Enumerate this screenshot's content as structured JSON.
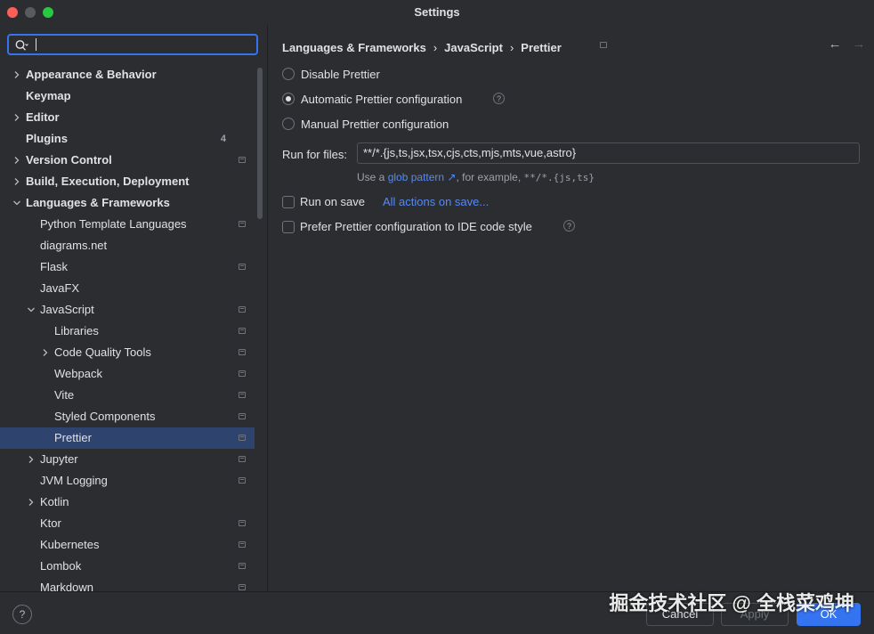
{
  "window": {
    "title": "Settings"
  },
  "search": {
    "value": ""
  },
  "sidebar": {
    "items": [
      {
        "label": "Appearance & Behavior",
        "level": 0,
        "bold": true,
        "chevron": "right",
        "badge": "",
        "project": false,
        "selected": false
      },
      {
        "label": "Keymap",
        "level": 0,
        "bold": true,
        "chevron": "",
        "badge": "",
        "project": false,
        "selected": false
      },
      {
        "label": "Editor",
        "level": 0,
        "bold": true,
        "chevron": "right",
        "badge": "",
        "project": false,
        "selected": false
      },
      {
        "label": "Plugins",
        "level": 0,
        "bold": true,
        "chevron": "",
        "badge": "4",
        "project": false,
        "selected": false
      },
      {
        "label": "Version Control",
        "level": 0,
        "bold": true,
        "chevron": "right",
        "badge": "",
        "project": true,
        "selected": false
      },
      {
        "label": "Build, Execution, Deployment",
        "level": 0,
        "bold": true,
        "chevron": "right",
        "badge": "",
        "project": false,
        "selected": false
      },
      {
        "label": "Languages & Frameworks",
        "level": 0,
        "bold": true,
        "chevron": "down",
        "badge": "",
        "project": false,
        "selected": false
      },
      {
        "label": "Python Template Languages",
        "level": 1,
        "bold": false,
        "chevron": "",
        "badge": "",
        "project": true,
        "selected": false
      },
      {
        "label": "diagrams.net",
        "level": 1,
        "bold": false,
        "chevron": "",
        "badge": "",
        "project": false,
        "selected": false
      },
      {
        "label": "Flask",
        "level": 1,
        "bold": false,
        "chevron": "",
        "badge": "",
        "project": true,
        "selected": false
      },
      {
        "label": "JavaFX",
        "level": 1,
        "bold": false,
        "chevron": "",
        "badge": "",
        "project": false,
        "selected": false
      },
      {
        "label": "JavaScript",
        "level": 1,
        "bold": false,
        "chevron": "down",
        "badge": "",
        "project": true,
        "selected": false
      },
      {
        "label": "Libraries",
        "level": 2,
        "bold": false,
        "chevron": "",
        "badge": "",
        "project": true,
        "selected": false
      },
      {
        "label": "Code Quality Tools",
        "level": 2,
        "bold": false,
        "chevron": "right",
        "badge": "",
        "project": true,
        "selected": false
      },
      {
        "label": "Webpack",
        "level": 2,
        "bold": false,
        "chevron": "",
        "badge": "",
        "project": true,
        "selected": false
      },
      {
        "label": "Vite",
        "level": 2,
        "bold": false,
        "chevron": "",
        "badge": "",
        "project": true,
        "selected": false
      },
      {
        "label": "Styled Components",
        "level": 2,
        "bold": false,
        "chevron": "",
        "badge": "",
        "project": true,
        "selected": false
      },
      {
        "label": "Prettier",
        "level": 2,
        "bold": false,
        "chevron": "",
        "badge": "",
        "project": true,
        "selected": true
      },
      {
        "label": "Jupyter",
        "level": 1,
        "bold": false,
        "chevron": "right",
        "badge": "",
        "project": true,
        "selected": false
      },
      {
        "label": "JVM Logging",
        "level": 1,
        "bold": false,
        "chevron": "",
        "badge": "",
        "project": true,
        "selected": false
      },
      {
        "label": "Kotlin",
        "level": 1,
        "bold": false,
        "chevron": "right",
        "badge": "",
        "project": false,
        "selected": false
      },
      {
        "label": "Ktor",
        "level": 1,
        "bold": false,
        "chevron": "",
        "badge": "",
        "project": true,
        "selected": false
      },
      {
        "label": "Kubernetes",
        "level": 1,
        "bold": false,
        "chevron": "",
        "badge": "",
        "project": true,
        "selected": false
      },
      {
        "label": "Lombok",
        "level": 1,
        "bold": false,
        "chevron": "",
        "badge": "",
        "project": true,
        "selected": false
      },
      {
        "label": "Markdown",
        "level": 1,
        "bold": false,
        "chevron": "",
        "badge": "",
        "project": true,
        "selected": false
      }
    ]
  },
  "breadcrumb": [
    "Languages & Frameworks",
    "JavaScript",
    "Prettier"
  ],
  "breadcrumb_sep": "›",
  "nav": {
    "back_icon": "arrow-left-icon",
    "forward_icon": "arrow-right-icon"
  },
  "prettier": {
    "radio_disable": "Disable Prettier",
    "radio_automatic": "Automatic Prettier configuration",
    "radio_manual": "Manual Prettier configuration",
    "selected_mode": "automatic",
    "run_for_files_label": "Run for files:",
    "run_for_files_value": "**/*.{js,ts,jsx,tsx,cjs,cts,mjs,mts,vue,astro}",
    "hint_prefix": "Use a",
    "hint_link": "glob pattern ↗",
    "hint_middle": ", for example,",
    "hint_example": "**/*.{js,ts}",
    "run_on_save_label": "Run on save",
    "run_on_save_checked": false,
    "all_actions_link": "All actions on save...",
    "prefer_config_label": "Prefer Prettier configuration to IDE code style",
    "prefer_config_checked": false
  },
  "footer": {
    "help_label": "?",
    "cancel_label": "Cancel",
    "apply_label": "Apply",
    "ok_label": "OK"
  },
  "watermark": "掘金技术社区 @ 全栈菜鸡坤",
  "colors": {
    "accent": "#3574f0",
    "selected_row": "#2e436e",
    "link": "#548af7",
    "background": "#2b2d30"
  }
}
